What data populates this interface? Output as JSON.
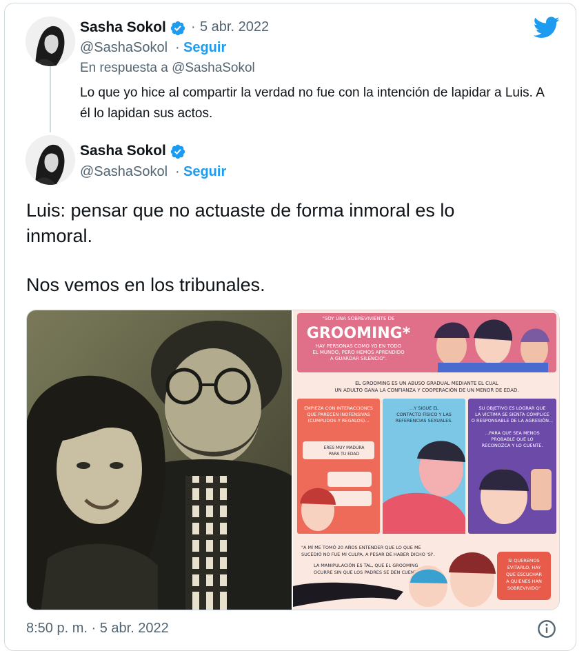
{
  "reply_tweet": {
    "author_name": "Sasha Sokol",
    "separator": "·",
    "date": "5 abr. 2022",
    "handle": "@SashaSokol",
    "follow_label": "Seguir",
    "in_reply_prefix": "En respuesta a ",
    "in_reply_handle": "@SashaSokol",
    "text": "Lo que yo hice al compartir la verdad no fue con la intención de lapidar a Luis. A él lo lapidan sus actos."
  },
  "main_tweet": {
    "author_name": "Sasha Sokol",
    "handle": "@SashaSokol",
    "separator": "·",
    "follow_label": "Seguir",
    "text_line1": "Luis: pensar que no actuaste de forma inmoral es lo",
    "text_line2": "inmoral.",
    "text_line3": "Nos vemos en los tribunales."
  },
  "infographic": {
    "top_quote": "\"SOY UNA SOBREVIVIENTE DE",
    "title": "GROOMING*",
    "subtitle1": "HAY PERSONAS COMO YO EN TODO",
    "subtitle2": "EL MUNDO, PERO HEMOS APRENDIDO",
    "subtitle3": "A GUARDAR SILENCIO\".",
    "def1": "EL GROOMING ES UN ABUSO GRADUAL MEDIANTE EL CUAL",
    "def2": "UN ADULTO GANA LA CONFIANZA Y COOPERACIÓN DE UN MENOR DE EDAD.",
    "p1_l1": "EMPIEZA CON INTERACCIONES",
    "p1_l2": "QUE PARECEN INOFENSIVAS",
    "p1_l3": "(CUMPLIDOS Y REGALOS)...",
    "p1_bubble1": "ERES MUY MADURA",
    "p1_bubble2": "PARA TU EDAD",
    "p2_l1": "...Y SIGUE EL",
    "p2_l2": "CONTACTO FÍSICO Y LAS",
    "p2_l3": "REFERENCIAS SEXUALES.",
    "p3_l1": "SU OBJETIVO ES LOGRAR QUE",
    "p3_l2": "LA VÍCTIMA SE SIENTA CÓMPLICE",
    "p3_l3": "O RESPONSABLE DE LA AGRESIÓN...",
    "p3_l4": "...PARA QUE SEA MENOS",
    "p3_l5": "PROBABLE QUE LO",
    "p3_l6": "RECONOZCA Y LO CUENTE.",
    "b1": "\"A MÍ ME TOMÓ 20 AÑOS ENTENDER QUE LO QUE ME",
    "b2": "SUCEDIÓ NO FUE MI CULPA, A PESAR DE HABER DICHO 'SÍ'.",
    "b3": "LA MANIPULACIÓN ES TAL, QUE EL GROOMING",
    "b4": "OCURRE SIN QUE LOS PADRES SE DEN CUENTA.",
    "red1": "SI QUEREMOS",
    "red2": "EVITARLO, HAY",
    "red3": "QUE ESCUCHAR",
    "red4": "A QUIENES HAN",
    "red5": "SOBREVIVIDO\""
  },
  "footer": {
    "timestamp": "8:50 p. m. · 5 abr. 2022"
  },
  "icons": {
    "brand": "twitter-bird-icon",
    "verified": "verified-badge-icon",
    "info": "info-icon"
  },
  "colors": {
    "brand_blue": "#1d9bf0",
    "text": "#0f1419",
    "muted": "#536471"
  }
}
